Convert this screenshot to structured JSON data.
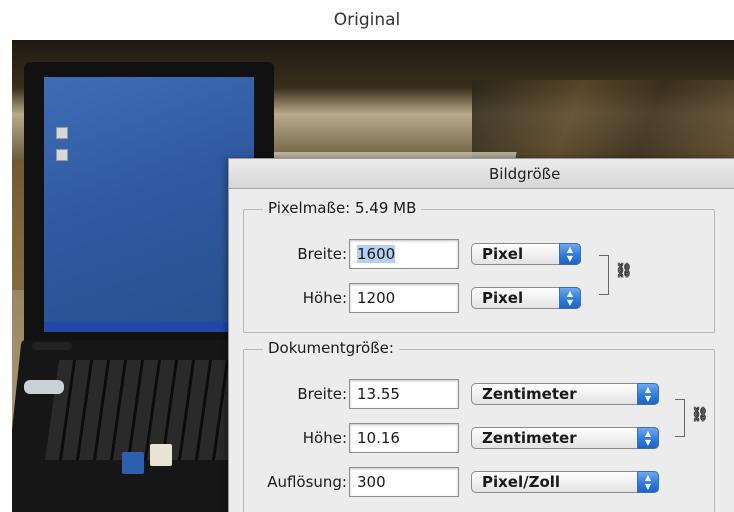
{
  "caption": "Original",
  "dialog": {
    "title": "Bildgröße",
    "pixel_section": {
      "legend": "Pixelmaße: 5.49 MB",
      "width_label": "Breite:",
      "width_value": "1600",
      "width_unit": "Pixel",
      "height_label": "Höhe:",
      "height_value": "1200",
      "height_unit": "Pixel"
    },
    "document_section": {
      "legend": "Dokumentgröße:",
      "width_label": "Breite:",
      "width_value": "13.55",
      "width_unit": "Zentimeter",
      "height_label": "Höhe:",
      "height_value": "10.16",
      "height_unit": "Zentimeter",
      "resolution_label": "Auflösung:",
      "resolution_value": "300",
      "resolution_unit": "Pixel/Zoll"
    }
  },
  "colors": {
    "selection": "#b5d0f2",
    "popup_arrow": "#2f7ce0"
  },
  "icons": {
    "select_arrows": "up-down-arrows",
    "constrain": "chain-link"
  }
}
